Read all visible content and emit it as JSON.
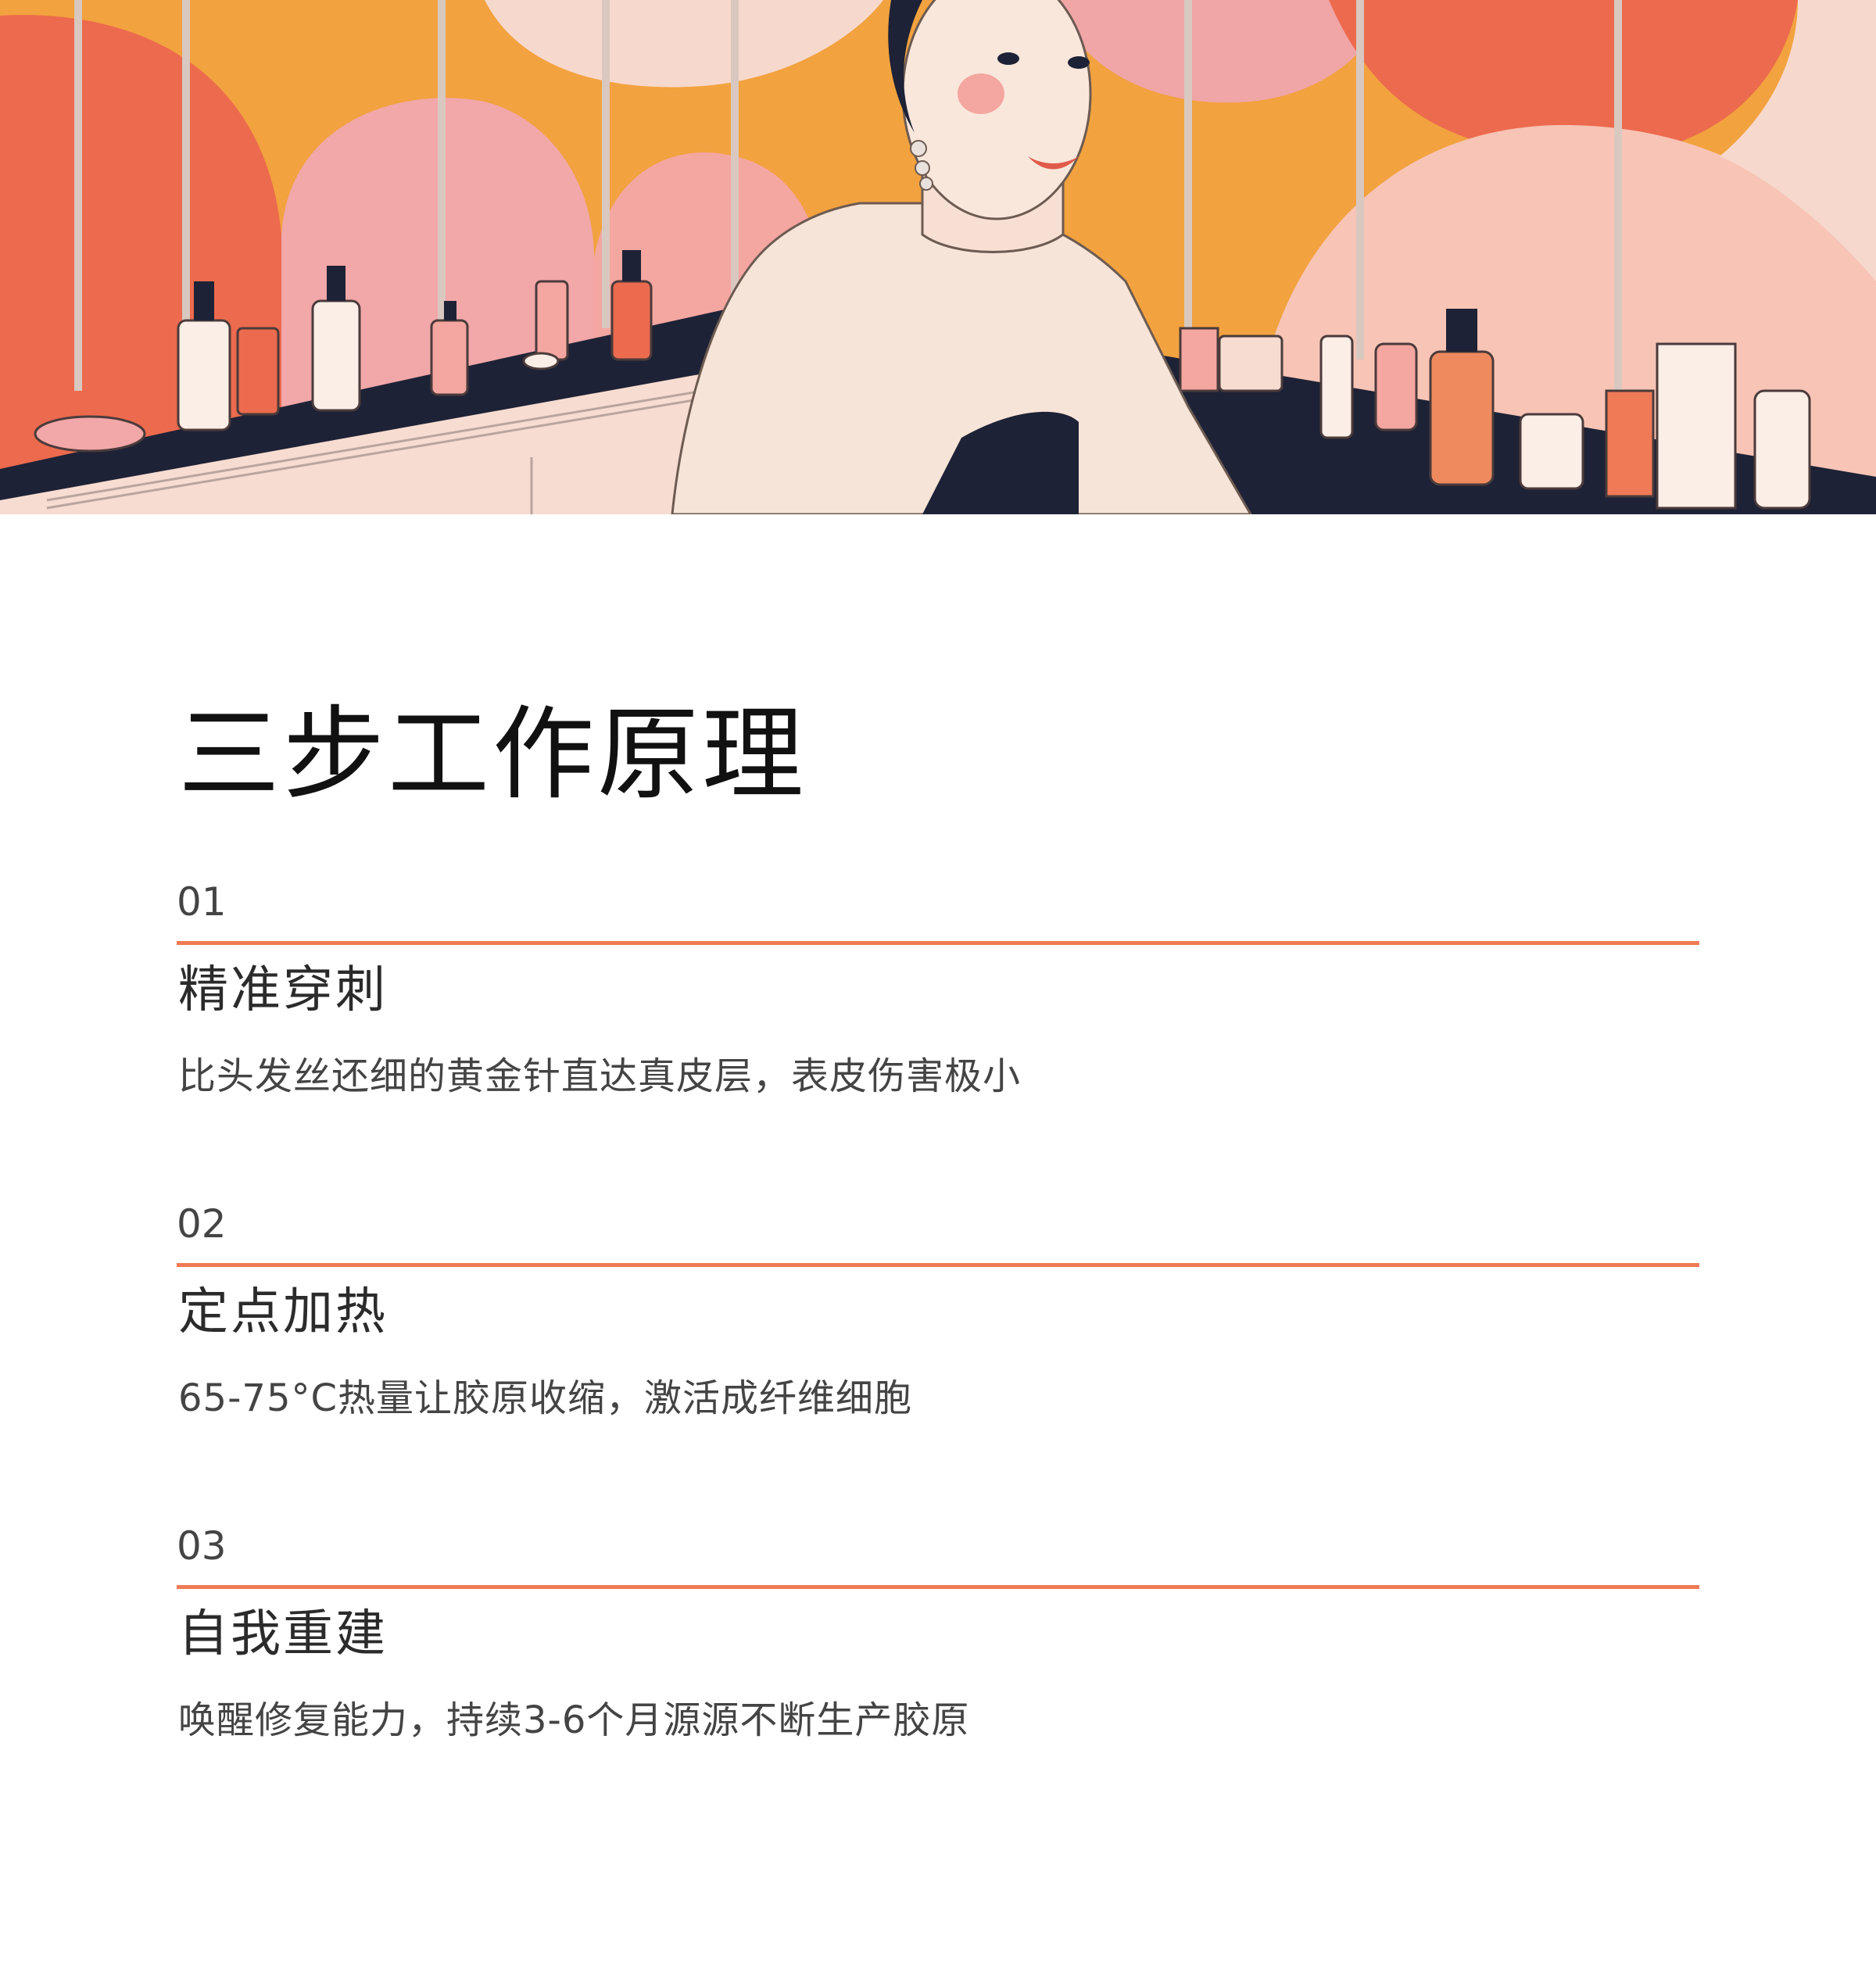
{
  "hero": {
    "image_label": "illustration-woman-vanity"
  },
  "page_title": "三步工作原理",
  "steps": [
    {
      "number": "01",
      "title": "精准穿刺",
      "description": "比头发丝还细的黄金针直达真皮层，表皮伤害极小"
    },
    {
      "number": "02",
      "title": "定点加热",
      "description": "65-75°C热量让胶原收缩，激活成纤维细胞"
    },
    {
      "number": "03",
      "title": "自我重建",
      "description": "唤醒修复能力，持续3-6个月源源不断生产胶原"
    }
  ],
  "colors": {
    "accent": "#ef7a55",
    "title_text": "#111111",
    "body_text": "#444444"
  }
}
